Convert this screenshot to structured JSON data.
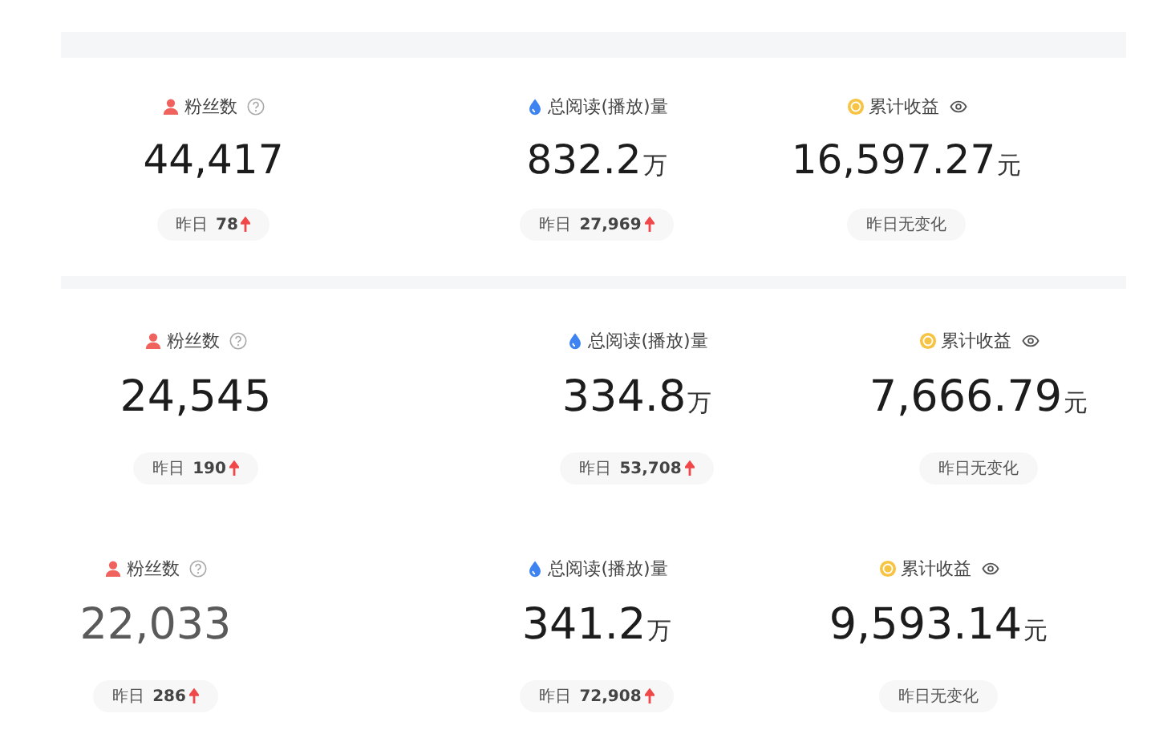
{
  "panels": [
    {
      "stats": [
        {
          "kind": "fans",
          "label": "粉丝数",
          "value": "44,417",
          "dim": false,
          "delta_label": "昨日",
          "delta": "78",
          "rising": true
        },
        {
          "kind": "reads",
          "label": "总阅读(播放)量",
          "value": "832.2",
          "unit": "万",
          "dim": false,
          "delta_label": "昨日",
          "delta": "27,969",
          "rising": true
        },
        {
          "kind": "income",
          "label": "累计收益",
          "value": "16,597.27",
          "unit": "元",
          "dim": false,
          "delta_label": "昨日无变化",
          "rising": false
        }
      ]
    },
    {
      "stats": [
        {
          "kind": "fans",
          "label": "粉丝数",
          "value": "24,545",
          "dim": false,
          "delta_label": "昨日",
          "delta": "190",
          "rising": true
        },
        {
          "kind": "reads",
          "label": "总阅读(播放)量",
          "value": "334.8",
          "unit": "万",
          "dim": false,
          "delta_label": "昨日",
          "delta": "53,708",
          "rising": true
        },
        {
          "kind": "income",
          "label": "累计收益",
          "value": "7,666.79",
          "unit": "元",
          "dim": false,
          "delta_label": "昨日无变化",
          "rising": false
        }
      ]
    },
    {
      "stats": [
        {
          "kind": "fans",
          "label": "粉丝数",
          "value": "22,033",
          "dim": true,
          "delta_label": "昨日",
          "delta": "286",
          "rising": true
        },
        {
          "kind": "reads",
          "label": "总阅读(播放)量",
          "value": "341.2",
          "unit": "万",
          "dim": false,
          "delta_label": "昨日",
          "delta": "72,908",
          "rising": true
        },
        {
          "kind": "income",
          "label": "累计收益",
          "value": "9,593.14",
          "unit": "元",
          "dim": false,
          "delta_label": "昨日无变化",
          "rising": false
        }
      ]
    }
  ]
}
